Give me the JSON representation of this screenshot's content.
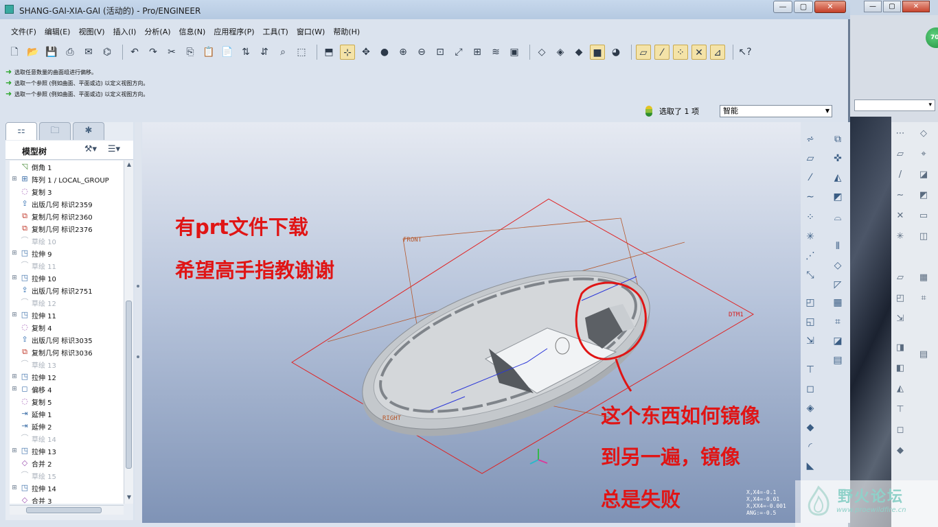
{
  "window": {
    "title": "SHANG-GAI-XIA-GAI (活动的) - Pro/ENGINEER",
    "controls": {
      "minimize": "—",
      "maximize": "▢",
      "close": "✕"
    }
  },
  "menu": [
    "文件(F)",
    "编辑(E)",
    "视图(V)",
    "插入(I)",
    "分析(A)",
    "信息(N)",
    "应用程序(P)",
    "工具(T)",
    "窗口(W)",
    "帮助(H)"
  ],
  "messages": [
    "选取任意数量的曲面组进行偏移。",
    "选取一个参照 (例如曲面、平面或边) 以定义视图方向。",
    "选取一个参照 (例如曲面、平面或边) 以定义视图方向。"
  ],
  "status": {
    "selected": "选取了 1 项",
    "filter": "智能"
  },
  "model_tree": {
    "title": "模型树",
    "items": [
      {
        "label": "倒角 1",
        "icon": "chamfer-icon",
        "dim": false,
        "expand": ""
      },
      {
        "label": "阵列 1 / LOCAL_GROUP",
        "icon": "pattern-icon",
        "dim": false,
        "expand": "+"
      },
      {
        "label": "复制 3",
        "icon": "copy-surface-icon",
        "dim": false,
        "expand": ""
      },
      {
        "label": "出版几何 标识2359",
        "icon": "publish-geom-icon",
        "dim": false,
        "expand": ""
      },
      {
        "label": "复制几何 标识2360",
        "icon": "copy-geom-icon",
        "dim": false,
        "expand": ""
      },
      {
        "label": "复制几何 标识2376",
        "icon": "copy-geom-icon",
        "dim": false,
        "expand": ""
      },
      {
        "label": "草绘 10",
        "icon": "sketch-icon",
        "dim": true,
        "expand": ""
      },
      {
        "label": "拉伸 9",
        "icon": "extrude-icon",
        "dim": false,
        "expand": "+"
      },
      {
        "label": "草绘 11",
        "icon": "sketch-icon",
        "dim": true,
        "expand": ""
      },
      {
        "label": "拉伸 10",
        "icon": "extrude-icon",
        "dim": false,
        "expand": "+"
      },
      {
        "label": "出版几何 标识2751",
        "icon": "publish-geom-icon",
        "dim": false,
        "expand": ""
      },
      {
        "label": "草绘 12",
        "icon": "sketch-icon",
        "dim": true,
        "expand": ""
      },
      {
        "label": "拉伸 11",
        "icon": "extrude-icon",
        "dim": false,
        "expand": "+"
      },
      {
        "label": "复制 4",
        "icon": "copy-surface-icon",
        "dim": false,
        "expand": ""
      },
      {
        "label": "出版几何 标识3035",
        "icon": "publish-geom-icon",
        "dim": false,
        "expand": ""
      },
      {
        "label": "复制几何 标识3036",
        "icon": "copy-geom-icon",
        "dim": false,
        "expand": ""
      },
      {
        "label": "草绘 13",
        "icon": "sketch-icon",
        "dim": true,
        "expand": ""
      },
      {
        "label": "拉伸 12",
        "icon": "extrude-icon",
        "dim": false,
        "expand": "+"
      },
      {
        "label": "偏移 4",
        "icon": "offset-icon",
        "dim": false,
        "expand": "+"
      },
      {
        "label": "复制 5",
        "icon": "copy-surface-icon",
        "dim": false,
        "expand": ""
      },
      {
        "label": "延伸 1",
        "icon": "extend-icon",
        "dim": false,
        "expand": ""
      },
      {
        "label": "延伸 2",
        "icon": "extend-icon",
        "dim": false,
        "expand": ""
      },
      {
        "label": "草绘 14",
        "icon": "sketch-icon",
        "dim": true,
        "expand": ""
      },
      {
        "label": "拉伸 13",
        "icon": "extrude-icon",
        "dim": false,
        "expand": "+"
      },
      {
        "label": "合并 2",
        "icon": "merge-icon",
        "dim": false,
        "expand": ""
      },
      {
        "label": "草绘 15",
        "icon": "sketch-icon",
        "dim": true,
        "expand": ""
      },
      {
        "label": "拉伸 14",
        "icon": "extrude-icon",
        "dim": false,
        "expand": "+"
      },
      {
        "label": "合并 3",
        "icon": "merge-icon",
        "dim": false,
        "expand": ""
      }
    ]
  },
  "annotations": {
    "top_line1": "有prt文件下载",
    "top_line2": "希望高手指教谢谢",
    "bottom_line1": "这个东西如何镜像",
    "bottom_line2": "到另一遍，镜像",
    "bottom_line3": "总是失败"
  },
  "datum_labels": {
    "front": "FRONT",
    "dtm1": "DTM1",
    "right": "RIGHT"
  },
  "coordinate_readout": [
    "X,X4=-0.1",
    "X,X4=-0.01",
    "X,XX4=-0.001",
    "ANG:=-0.5"
  ],
  "watermark": {
    "name": "野火论坛",
    "url": "www.proewildfire.cn"
  },
  "background_window": {
    "badge": "70",
    "dropdown_caret": "▾"
  },
  "colors": {
    "annotation": "#e01515",
    "datum_plane": "#e02020",
    "datum_axis_brown": "#b5562a",
    "part_body": "#c4c8cc"
  }
}
